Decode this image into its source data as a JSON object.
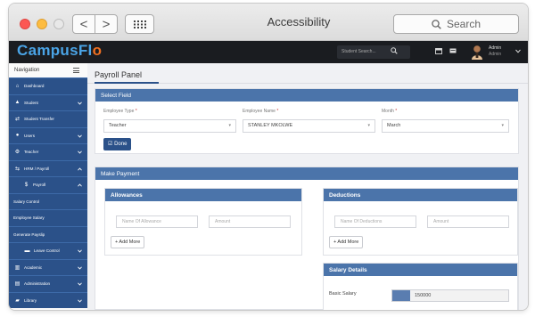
{
  "window": {
    "title": "Accessibility",
    "search_placeholder": "Search",
    "back_glyph": "<",
    "forward_glyph": ">"
  },
  "app": {
    "logo_main": "CampusFl",
    "logo_accent": "o",
    "brand_color": "#4aa4e6",
    "accent_color": "#f07021",
    "header_search_placeholder": "Student Search...",
    "user_name": "Admin",
    "user_role": "Admin"
  },
  "sidebar": {
    "header": "Navigation",
    "items": [
      {
        "label": "Dashboard",
        "icon": "home-icon",
        "glyph": "⌂",
        "chevron": ""
      },
      {
        "label": "Student",
        "icon": "graduation-cap-icon",
        "glyph": "🎓",
        "chevron": "⌄"
      },
      {
        "label": "Student Transfer",
        "icon": "transfer-icon",
        "glyph": "⇄",
        "chevron": ""
      },
      {
        "label": "Users",
        "icon": "user-circle-icon",
        "glyph": "●",
        "chevron": "⌄"
      },
      {
        "label": "Teacher",
        "icon": "teacher-icon",
        "glyph": "⚙",
        "chevron": "⌄"
      },
      {
        "label": "HRM / Payroll",
        "icon": "money-icon",
        "glyph": "⇆",
        "chevron": "⌃"
      },
      {
        "label": "Payroll",
        "icon": "dollar-icon",
        "glyph": "$",
        "chevron": "⌃"
      },
      {
        "label": "Salary Control",
        "icon": "",
        "glyph": "",
        "chevron": ""
      },
      {
        "label": "Employee Salary",
        "icon": "",
        "glyph": "",
        "chevron": ""
      },
      {
        "label": "Generate Payslip",
        "icon": "",
        "glyph": "",
        "chevron": ""
      },
      {
        "label": "Leave Control",
        "icon": "bed-icon",
        "glyph": "▬",
        "chevron": "⌄"
      },
      {
        "label": "Academic",
        "icon": "institution-icon",
        "glyph": "▥",
        "chevron": "⌄"
      },
      {
        "label": "Administration",
        "icon": "bar-chart-icon",
        "glyph": "▤",
        "chevron": "⌄"
      },
      {
        "label": "Library",
        "icon": "book-icon",
        "glyph": "▰",
        "chevron": "⌄"
      }
    ]
  },
  "main": {
    "panel_title": "Payroll Panel",
    "select_field": {
      "header": "Select Field",
      "employee_type_label": "Employee Type",
      "employee_type_value": "Teacher",
      "employee_name_label": "Employee Name",
      "employee_name_value": "STANLEY MKOLWE",
      "month_label": "Month",
      "month_value": "March",
      "required_mark": "*",
      "done_label": "Done"
    },
    "make_payment": {
      "header": "Make Payment",
      "allowances": {
        "header": "Allowances",
        "name_placeholder": "Name Of Allowance",
        "amount_placeholder": "Amount",
        "add_label": "+ Add More"
      },
      "deductions": {
        "header": "Deductions",
        "name_placeholder": "Name Of Deductions",
        "amount_placeholder": "Amount",
        "add_label": "+ Add More"
      },
      "salary_details": {
        "header": "Salary Details",
        "basic_salary_label": "Basic Salary",
        "basic_salary_value": "150000"
      }
    }
  }
}
